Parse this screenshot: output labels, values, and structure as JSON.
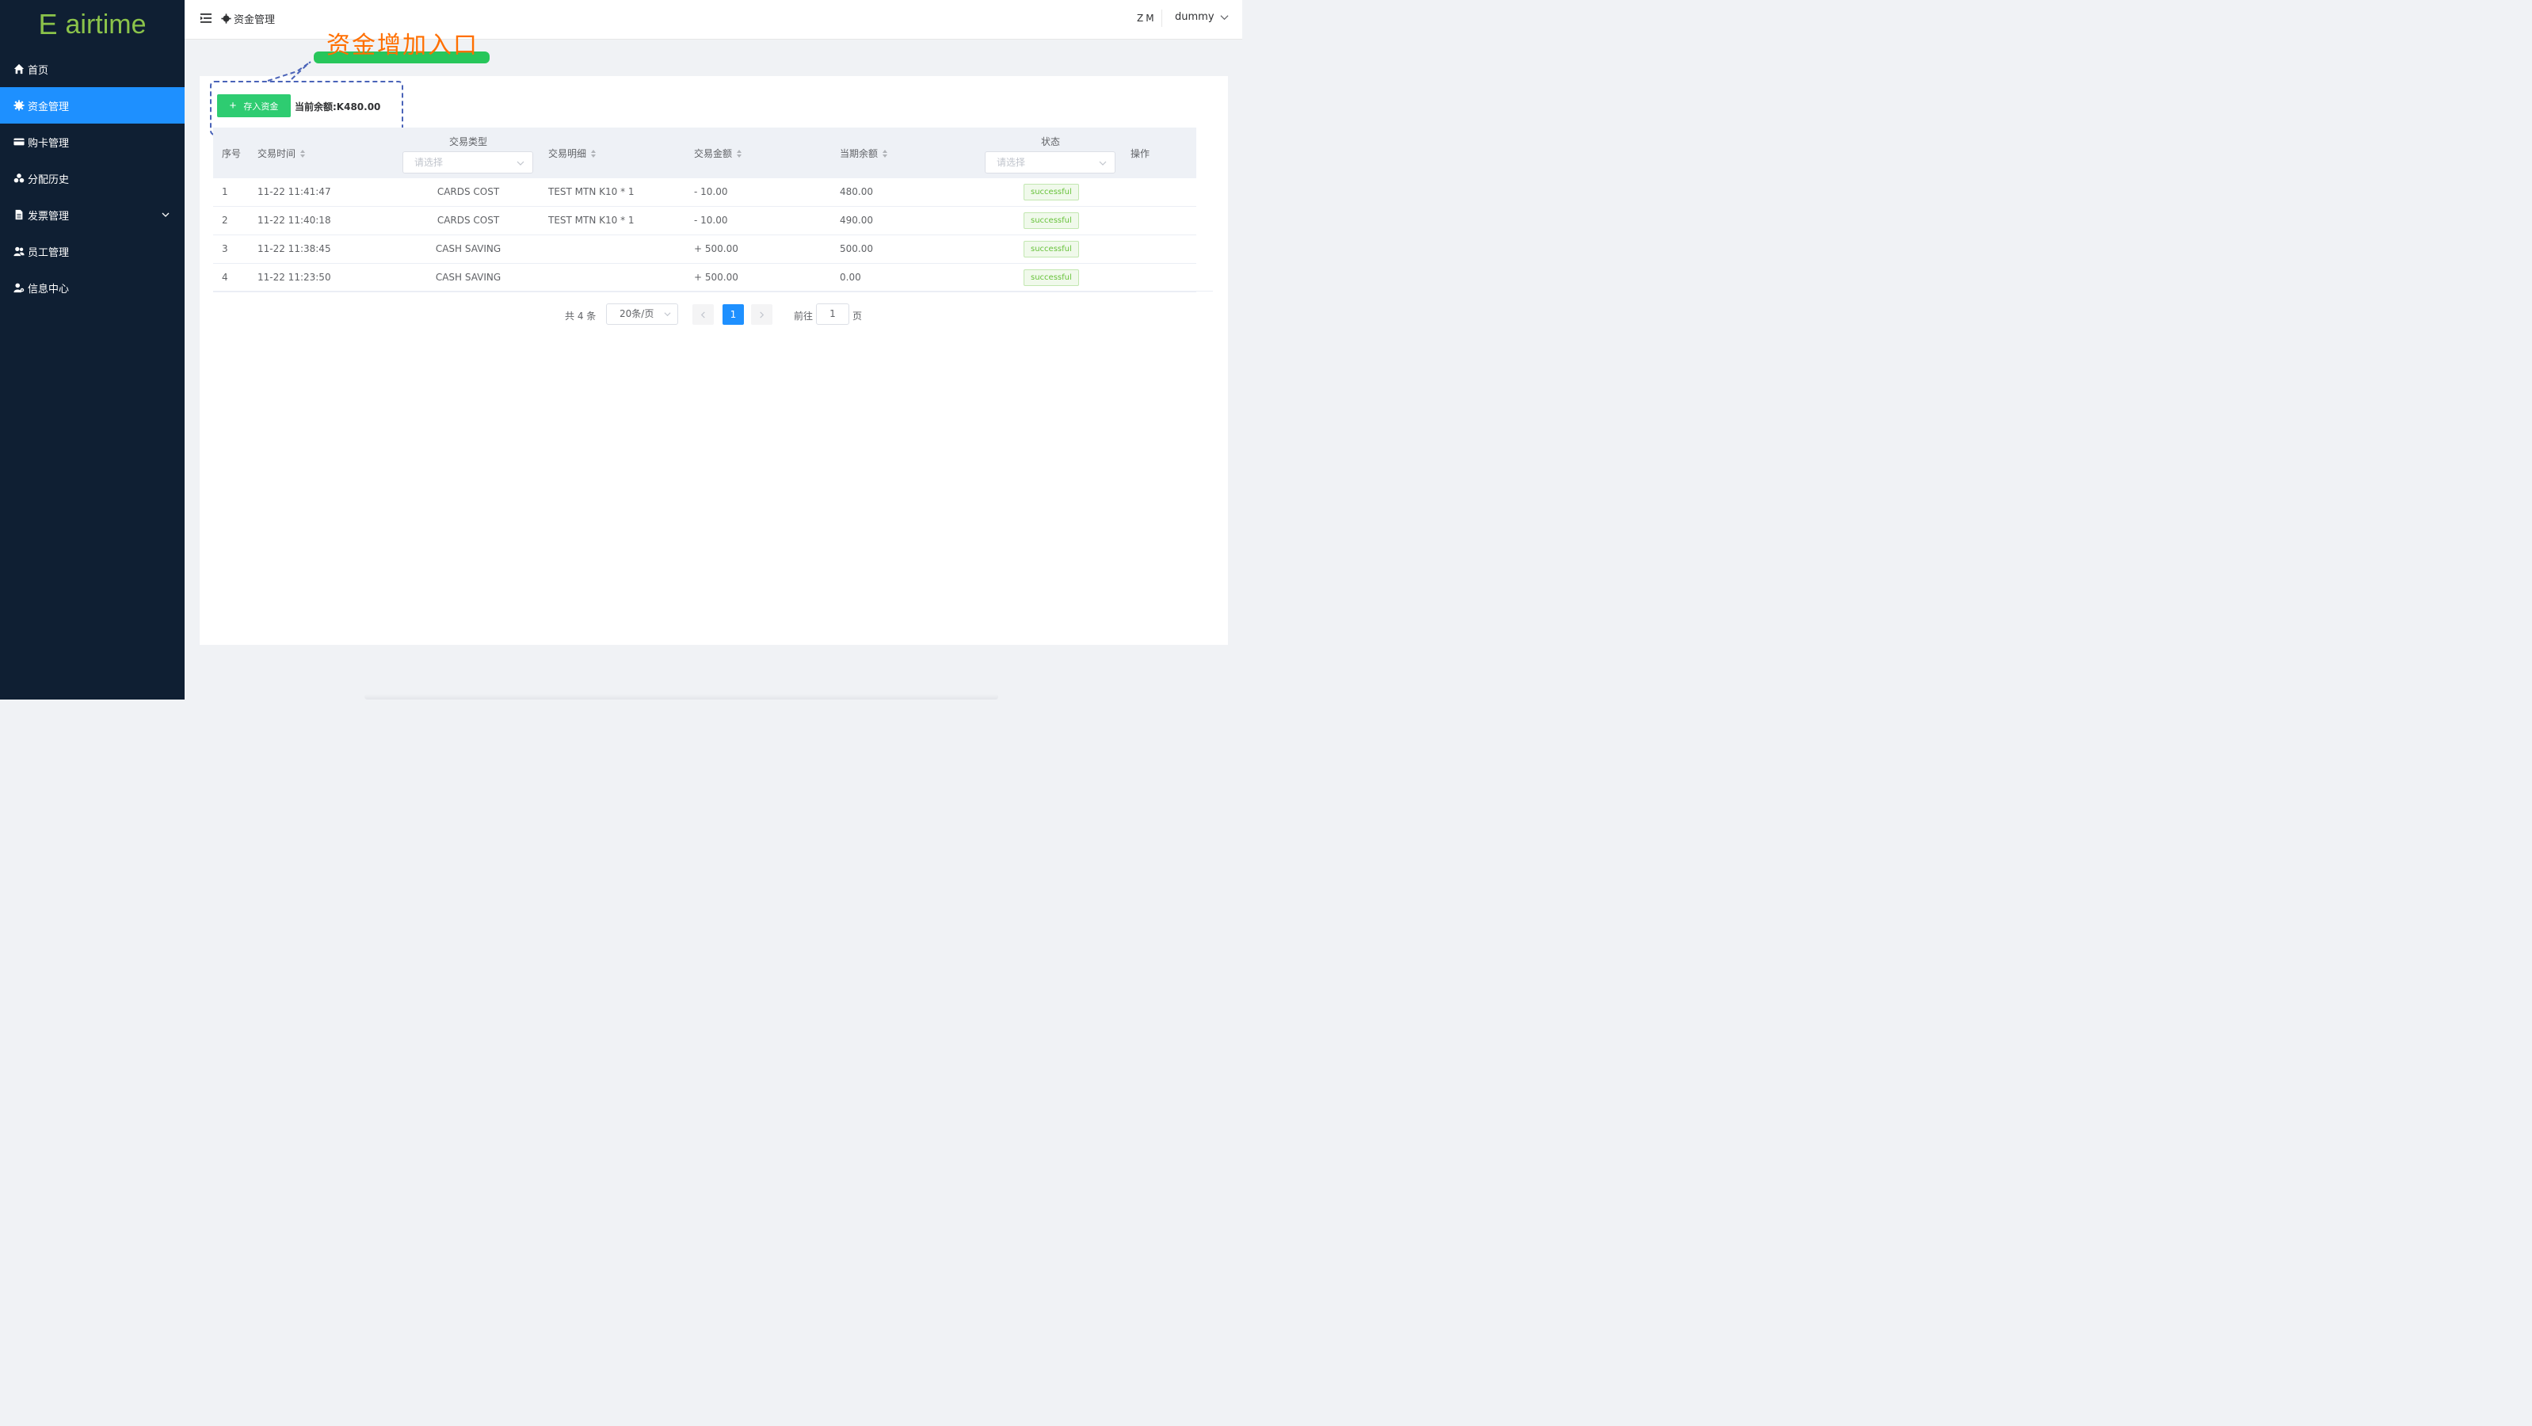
{
  "brand": {
    "letter": "E",
    "name": "airtime"
  },
  "sidebar": {
    "items": [
      {
        "label": "首页",
        "icon": "home-icon"
      },
      {
        "label": "资金管理",
        "icon": "gear-icon",
        "active": true
      },
      {
        "label": "购卡管理",
        "icon": "credit-card-icon"
      },
      {
        "label": "分配历史",
        "icon": "cubes-icon"
      },
      {
        "label": "发票管理",
        "icon": "file-icon",
        "has_submenu": true
      },
      {
        "label": "员工管理",
        "icon": "users-icon"
      },
      {
        "label": "信息中心",
        "icon": "user-cog-icon"
      }
    ]
  },
  "header": {
    "breadcrumb": "资金管理",
    "lang": "ZM",
    "username": "dummy"
  },
  "toolbar": {
    "deposit_button": "存入资金",
    "balance_text": "当前余额:K480.00"
  },
  "annotation": {
    "text": "资金增加入口"
  },
  "table": {
    "headers": {
      "index": "序号",
      "time": "交易时间",
      "type": "交易类型",
      "detail": "交易明细",
      "amount": "交易金额",
      "balance": "当期余额",
      "status": "状态",
      "action": "操作"
    },
    "type_filter_placeholder": "请选择",
    "status_filter_placeholder": "请选择",
    "rows": [
      {
        "index": "1",
        "time": "11-22 11:41:47",
        "type": "CARDS COST",
        "detail": "TEST MTN K10 * 1",
        "amount": "- 10.00",
        "balance": "480.00",
        "status": "successful"
      },
      {
        "index": "2",
        "time": "11-22 11:40:18",
        "type": "CARDS COST",
        "detail": "TEST MTN K10 * 1",
        "amount": "- 10.00",
        "balance": "490.00",
        "status": "successful"
      },
      {
        "index": "3",
        "time": "11-22 11:38:45",
        "type": "CASH SAVING",
        "detail": "",
        "amount": "+ 500.00",
        "balance": "500.00",
        "status": "successful"
      },
      {
        "index": "4",
        "time": "11-22 11:23:50",
        "type": "CASH SAVING",
        "detail": "",
        "amount": "+ 500.00",
        "balance": "0.00",
        "status": "successful"
      }
    ]
  },
  "pagination": {
    "total_text": "共 4 条",
    "page_size": "20条/页",
    "current_page": "1",
    "goto_label": "前往",
    "goto_value": "1",
    "page_suffix": "页"
  },
  "colors": {
    "sidebar_bg": "#0f1f33",
    "active": "#1e90ff",
    "brand_green": "#8bc34a",
    "deposit_green": "#2ecc71",
    "annotation_orange": "#ff6f00",
    "annotation_box": "#4a63b8",
    "success": "#67c23a"
  }
}
